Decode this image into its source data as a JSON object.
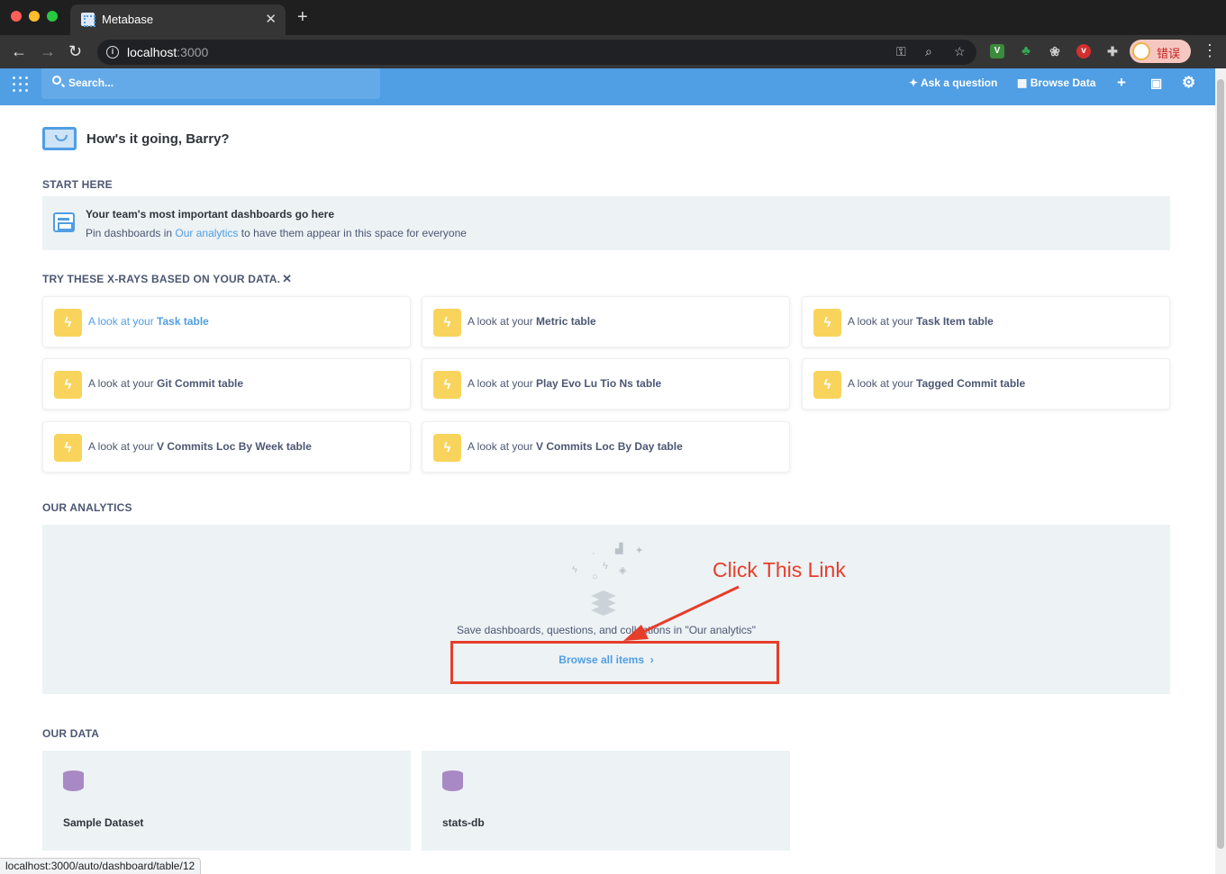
{
  "browser": {
    "tab_title": "Metabase",
    "url_host": "localhost",
    "url_port": ":3000",
    "profile_label": "错误",
    "status_url": "localhost:3000/auto/dashboard/table/12"
  },
  "nav": {
    "search_placeholder": "Search...",
    "ask_question": "Ask a question",
    "browse_data": "Browse Data"
  },
  "greeting": "How's it going, Barry?",
  "start_here": {
    "title": "START HERE",
    "pin_title": "Your team's most important dashboards go here",
    "pin_prefix": "Pin dashboards in ",
    "pin_link": "Our analytics",
    "pin_suffix": " to have them appear in this space for everyone"
  },
  "xrays": {
    "title": "TRY THESE X-RAYS BASED ON YOUR DATA.",
    "close": "✕",
    "prefix": "A look at your ",
    "items": [
      {
        "name": "Task table"
      },
      {
        "name": "Metric table"
      },
      {
        "name": "Task Item table"
      },
      {
        "name": "Git Commit table"
      },
      {
        "name": "Play Evo Lu Tio Ns table"
      },
      {
        "name": "Tagged Commit table"
      },
      {
        "name": "V Commits Loc By Week table"
      },
      {
        "name": "V Commits Loc By Day table"
      }
    ]
  },
  "our_analytics": {
    "title": "OUR ANALYTICS",
    "empty_text": "Save dashboards, questions, and collections in \"Our analytics\"",
    "browse_link": "Browse all items",
    "browse_chevron": "›"
  },
  "annotation": {
    "text": "Click This Link",
    "color": "#e53e2a"
  },
  "our_data": {
    "title": "OUR DATA",
    "items": [
      "Sample Dataset",
      "stats-db"
    ]
  },
  "colors": {
    "brand": "#509ee3",
    "xray_bolt": "#f9d45c",
    "database": "#a989c5"
  }
}
